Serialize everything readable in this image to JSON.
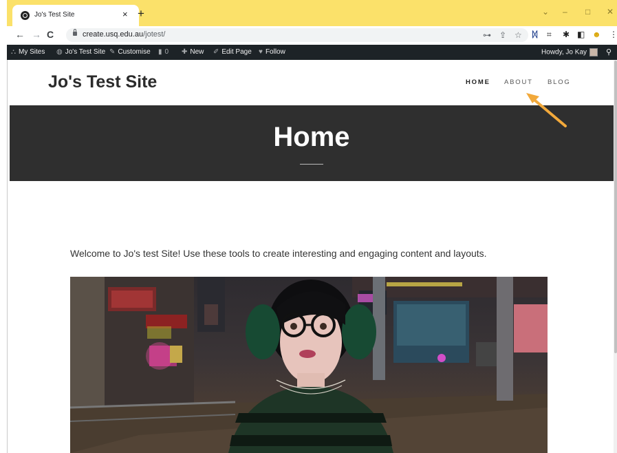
{
  "browser": {
    "tab_title": "Jo's Test Site",
    "tab_close": "×",
    "new_tab": "+",
    "url_host": "create.usq.edu.au",
    "url_path": "/jotest/",
    "win_min": "–",
    "win_max": "□",
    "win_close": "✕",
    "menu_glyph": "⋮"
  },
  "adminbar": {
    "my_sites": "My Sites",
    "site_name": "Jo's Test Site",
    "customise": "Customise",
    "comments_count": "0",
    "new": "New",
    "edit_page": "Edit Page",
    "follow": "Follow",
    "howdy": "Howdy, Jo Kay"
  },
  "site": {
    "title": "Jo's Test Site",
    "nav": [
      "HOME",
      "ABOUT",
      "BLOG"
    ]
  },
  "page": {
    "heading": "Home",
    "welcome": "Welcome to Jo's test Site! Use these tools to create interesting and engaging content and layouts."
  },
  "colors": {
    "tabstrip": "#fbe16a",
    "adminbar": "#1d2327",
    "hero": "#2f2f2f",
    "arrow": "#f2a93b"
  }
}
